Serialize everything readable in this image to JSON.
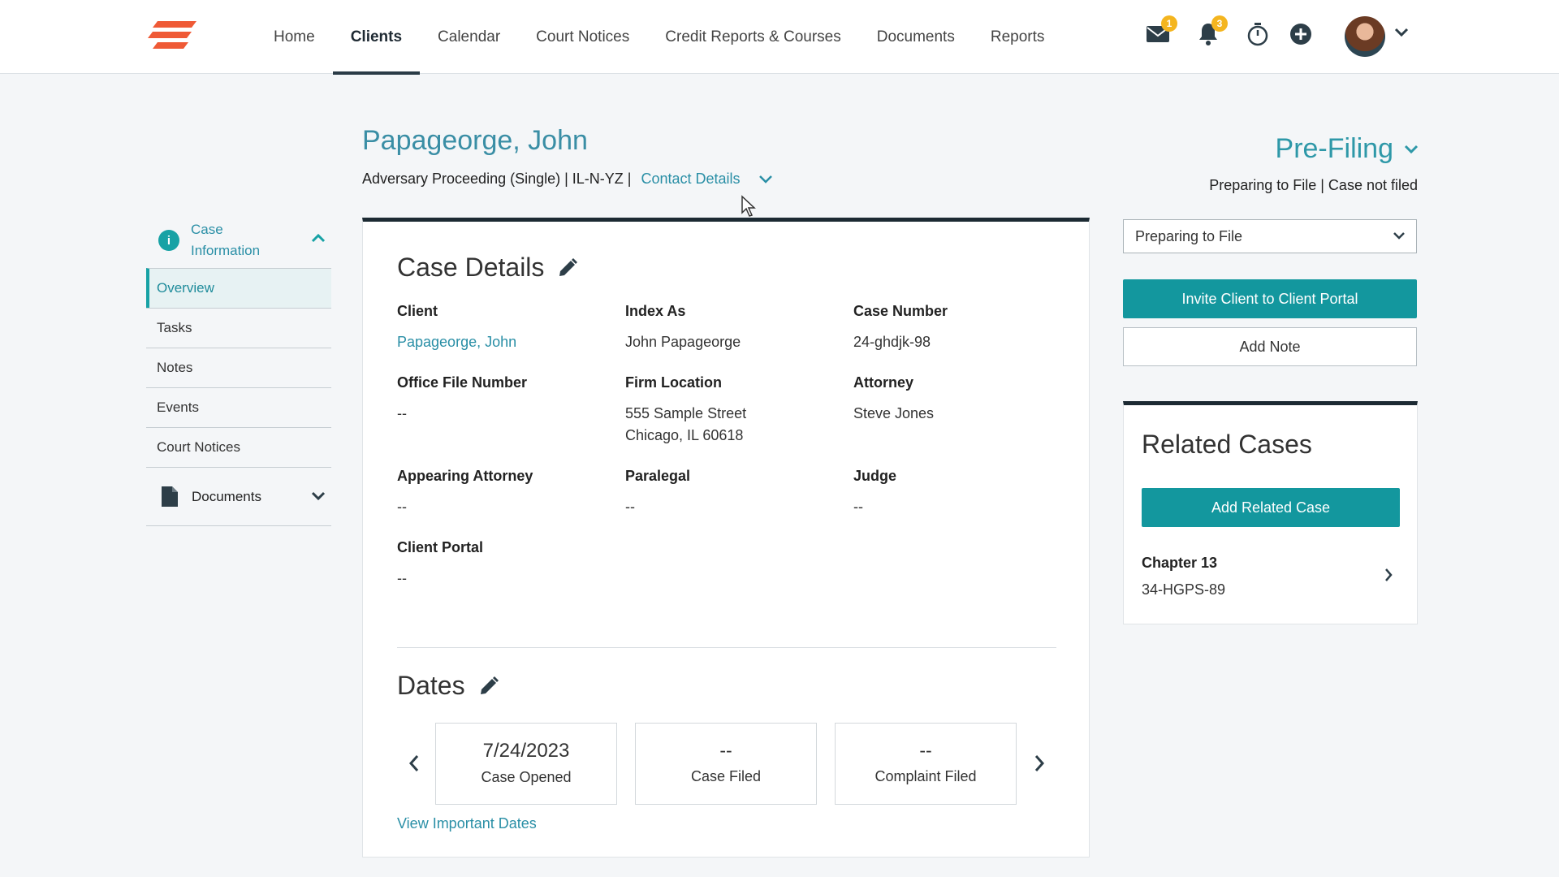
{
  "nav": {
    "items": [
      {
        "label": "Home",
        "active": false
      },
      {
        "label": "Clients",
        "active": true
      },
      {
        "label": "Calendar",
        "active": false
      },
      {
        "label": "Court Notices",
        "active": false
      },
      {
        "label": "Credit Reports & Courses",
        "active": false
      },
      {
        "label": "Documents",
        "active": false
      },
      {
        "label": "Reports",
        "active": false
      }
    ],
    "mail_badge": "1",
    "notif_badge": "3"
  },
  "header": {
    "client_name": "Papageorge, John",
    "case_subtitle": "Adversary Proceeding (Single) | IL-N-YZ |",
    "contact_details": "Contact Details",
    "stage": "Pre-Filing",
    "stage_status": "Preparing to File | Case not filed"
  },
  "sidebar": {
    "section_label": "Case Information",
    "items": [
      "Overview",
      "Tasks",
      "Notes",
      "Events",
      "Court Notices"
    ],
    "documents_label": "Documents"
  },
  "case_details": {
    "title": "Case Details",
    "fields": {
      "client": {
        "label": "Client",
        "value": "Papageorge, John"
      },
      "index_as": {
        "label": "Index As",
        "value": "John Papageorge"
      },
      "case_number": {
        "label": "Case Number",
        "value": "24-ghdjk-98"
      },
      "office_file_number": {
        "label": "Office File Number",
        "value": "--"
      },
      "firm_location": {
        "label": "Firm Location",
        "line1": "555 Sample Street",
        "line2": "Chicago, IL 60618"
      },
      "attorney": {
        "label": "Attorney",
        "value": "Steve Jones"
      },
      "appearing_attorney": {
        "label": "Appearing Attorney",
        "value": "--"
      },
      "paralegal": {
        "label": "Paralegal",
        "value": "--"
      },
      "judge": {
        "label": "Judge",
        "value": "--"
      },
      "client_portal": {
        "label": "Client Portal",
        "value": "--"
      }
    }
  },
  "dates": {
    "title": "Dates",
    "boxes": [
      {
        "date": "7/24/2023",
        "label": "Case Opened"
      },
      {
        "date": "--",
        "label": "Case Filed"
      },
      {
        "date": "--",
        "label": "Complaint Filed"
      }
    ],
    "view_link": "View Important Dates"
  },
  "right": {
    "status_select": "Preparing to File",
    "invite_button": "Invite Client to Client Portal",
    "add_note_button": "Add Note",
    "related_title": "Related Cases",
    "add_related_button": "Add Related Case",
    "related_case": {
      "chapter": "Chapter 13",
      "number": "34-HGPS-89"
    }
  },
  "colors": {
    "accent": "#13979e",
    "link": "#2a8fa6",
    "dark_rule": "#1c2a33",
    "badge": "#f4b51f",
    "logo": "#ef5a36"
  }
}
